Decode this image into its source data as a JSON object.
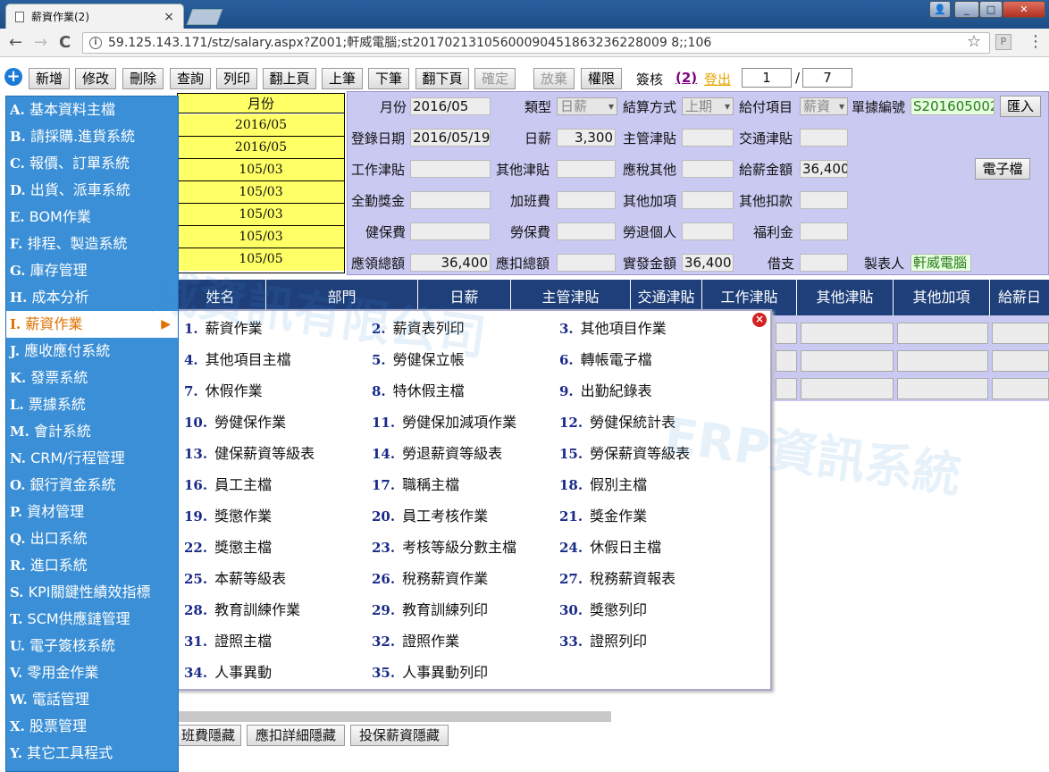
{
  "browser": {
    "tab_title": "薪資作業(2)",
    "tab_close": "×",
    "url": "59.125.143.171/stz/salary.aspx?Z001;軒威電腦;st20170213105600090451863236228009 8;;106",
    "win_min": "_",
    "win_max": "□",
    "win_close": "✕",
    "back": "←",
    "forward": "→",
    "reload": "C",
    "star": "☆",
    "ext": "P",
    "menu": "⋮",
    "info": "i"
  },
  "toolbar": {
    "add_icon": "+",
    "buttons": [
      "新增",
      "修改",
      "刪除",
      "查詢",
      "列印",
      "翻上頁",
      "上筆",
      "下筆",
      "翻下頁",
      "確定",
      "放棄",
      "權限"
    ],
    "sign_label": "簽核",
    "sign_count": "(2)",
    "logout": "登出",
    "page_current": "1",
    "page_sep": "/",
    "page_total": "7"
  },
  "left_list": {
    "header": "月份",
    "rows": [
      "2016/05",
      "2016/05",
      "105/03",
      "105/03",
      "105/03",
      "105/03",
      "105/05"
    ]
  },
  "form": {
    "month_label": "月份",
    "month": "2016/05",
    "type_label": "類型",
    "type": "日薪",
    "settle_label": "結算方式",
    "settle": "上期",
    "payitem_label": "給付項目",
    "payitem": "薪資",
    "docno_label": "單據編號",
    "docno": "S201605002",
    "import_btn": "匯入",
    "regdate_label": "登錄日期",
    "regdate": "2016/05/19",
    "dailypay_label": "日薪",
    "dailypay": "3,300",
    "mgr_allow_label": "主管津貼",
    "trans_allow_label": "交通津貼",
    "work_allow_label": "工作津貼",
    "other_allow_label": "其他津貼",
    "taxother_label": "應稅其他",
    "total_pay_label": "給薪金額",
    "total_pay": "36,400",
    "efile_btn": "電子檔",
    "attend_bonus_label": "全勤獎金",
    "overtime_label": "加班費",
    "other_add_label": "其他加項",
    "other_deduct_label": "其他扣款",
    "health_label": "健保費",
    "labor_label": "勞保費",
    "pension_label": "勞退個人",
    "welfare_label": "福利金",
    "gross_label": "應領總額",
    "gross": "36,400",
    "deduct_total_label": "應扣總額",
    "net_label": "實發金額",
    "net": "36,400",
    "advance_label": "借支",
    "maker_label": "製表人",
    "maker": "軒威電腦"
  },
  "grid": {
    "headers": [
      "姓名",
      "部門",
      "日薪",
      "主管津貼",
      "交通津貼",
      "工作津貼",
      "其他津貼",
      "其他加項",
      "給薪日"
    ]
  },
  "sidebar": {
    "items": [
      {
        "key": "A.",
        "label": "基本資料主檔"
      },
      {
        "key": "B.",
        "label": "請採購.進貨系統"
      },
      {
        "key": "C.",
        "label": "報價、訂單系統"
      },
      {
        "key": "D.",
        "label": "出貨、派車系統"
      },
      {
        "key": "E.",
        "label": "BOM作業"
      },
      {
        "key": "F.",
        "label": "排程、製造系統"
      },
      {
        "key": "G.",
        "label": "庫存管理"
      },
      {
        "key": "H.",
        "label": "成本分析"
      },
      {
        "key": "I.",
        "label": "薪資作業"
      },
      {
        "key": "J.",
        "label": "應收應付系統"
      },
      {
        "key": "K.",
        "label": "發票系統"
      },
      {
        "key": "L.",
        "label": "票據系統"
      },
      {
        "key": "M.",
        "label": "會計系統"
      },
      {
        "key": "N.",
        "label": "CRM/行程管理"
      },
      {
        "key": "O.",
        "label": "銀行資金系統"
      },
      {
        "key": "P.",
        "label": "資材管理"
      },
      {
        "key": "Q.",
        "label": "出口系統"
      },
      {
        "key": "R.",
        "label": "進口系統"
      },
      {
        "key": "S.",
        "label": "KPI關鍵性績效指標"
      },
      {
        "key": "T.",
        "label": "SCM供應鏈管理"
      },
      {
        "key": "U.",
        "label": "電子簽核系統"
      },
      {
        "key": "V.",
        "label": "零用金作業"
      },
      {
        "key": "W.",
        "label": "電話管理"
      },
      {
        "key": "X.",
        "label": "股票管理"
      },
      {
        "key": "Y.",
        "label": "其它工具程式"
      }
    ],
    "arrow": "▶"
  },
  "submenu": {
    "close": "×",
    "items": [
      {
        "n": "1.",
        "t": "薪資作業"
      },
      {
        "n": "2.",
        "t": "薪資表列印"
      },
      {
        "n": "3.",
        "t": "其他項目作業"
      },
      {
        "n": "4.",
        "t": "其他項目主檔"
      },
      {
        "n": "5.",
        "t": "勞健保立帳"
      },
      {
        "n": "6.",
        "t": "轉帳電子檔"
      },
      {
        "n": "7.",
        "t": "休假作業"
      },
      {
        "n": "8.",
        "t": "特休假主檔"
      },
      {
        "n": "9.",
        "t": "出勤紀錄表"
      },
      {
        "n": "10.",
        "t": "勞健保作業"
      },
      {
        "n": "11.",
        "t": "勞健保加減項作業"
      },
      {
        "n": "12.",
        "t": "勞健保統計表"
      },
      {
        "n": "13.",
        "t": "健保薪資等級表"
      },
      {
        "n": "14.",
        "t": "勞退薪資等級表"
      },
      {
        "n": "15.",
        "t": "勞保薪資等級表"
      },
      {
        "n": "16.",
        "t": "員工主檔"
      },
      {
        "n": "17.",
        "t": "職稱主檔"
      },
      {
        "n": "18.",
        "t": "假別主檔"
      },
      {
        "n": "19.",
        "t": "獎懲作業"
      },
      {
        "n": "20.",
        "t": "員工考核作業"
      },
      {
        "n": "21.",
        "t": "獎金作業"
      },
      {
        "n": "22.",
        "t": "獎懲主檔"
      },
      {
        "n": "23.",
        "t": "考核等級分數主檔"
      },
      {
        "n": "24.",
        "t": "休假日主檔"
      },
      {
        "n": "25.",
        "t": "本薪等級表"
      },
      {
        "n": "26.",
        "t": "稅務薪資作業"
      },
      {
        "n": "27.",
        "t": "稅務薪資報表"
      },
      {
        "n": "28.",
        "t": "教育訓練作業"
      },
      {
        "n": "29.",
        "t": "教育訓練列印"
      },
      {
        "n": "30.",
        "t": "獎懲列印"
      },
      {
        "n": "31.",
        "t": "證照主檔"
      },
      {
        "n": "32.",
        "t": "證照作業"
      },
      {
        "n": "33.",
        "t": "證照列印"
      },
      {
        "n": "34.",
        "t": "人事異動"
      },
      {
        "n": "35.",
        "t": "人事異動列印"
      }
    ]
  },
  "bottom_buttons": [
    "班費隱藏",
    "應扣詳細隱藏",
    "投保薪資隱藏"
  ],
  "watermark": {
    "line1": "軒威資訊有限公司",
    "line2": "ERP資訊系統"
  }
}
